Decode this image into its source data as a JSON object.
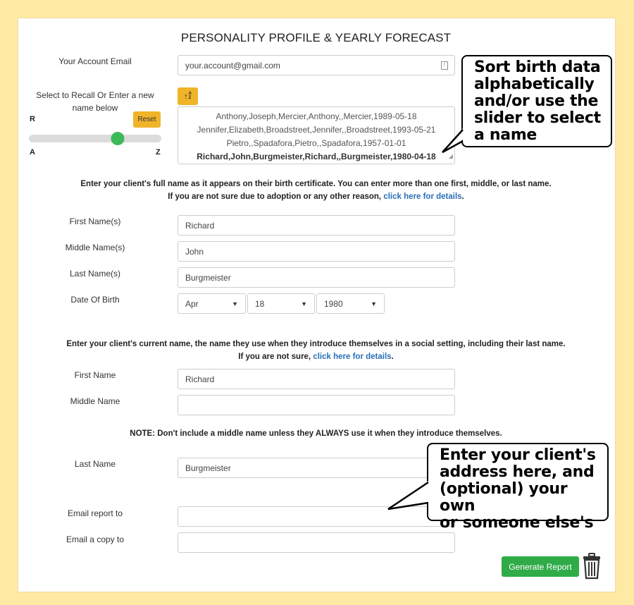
{
  "title": "PERSONALITY PROFILE & YEARLY FORECAST",
  "account": {
    "label": "Your Account Email",
    "value": "your.account@gmail.com",
    "icon": "contact-card-icon"
  },
  "recall": {
    "label": "Select to Recall Or Enter a new name below",
    "current_letter": "R",
    "reset_label": "Reset",
    "slider_min_label": "A",
    "slider_max_label": "Z",
    "slider_fraction": 0.67,
    "sort_icon": "sort-alpha-icon",
    "sort_glyph": "↑",
    "sort_az_top": "A",
    "sort_az_bottom": "Z",
    "names": [
      "Anthony,Joseph,Mercier,Anthony,,Mercier,1989-05-18",
      "Jennifer,Elizabeth,Broadstreet,Jennifer,,Broadstreet,1993-05-21",
      "Pietro,,Spadafora,Pietro,,Spadafora,1957-01-01",
      "Richard,John,Burgmeister,Richard,,Burgmeister,1980-04-18"
    ],
    "selected_index": 3
  },
  "birth_notice": {
    "line1": "Enter your client's full name as it appears on their birth certificate. You can enter more than one first, middle, or last name.",
    "line2_prefix": "If you are not sure due to adoption or any other reason, ",
    "link": "click here for details",
    "suffix": "."
  },
  "birth": {
    "first_label": "First Name(s)",
    "first_value": "Richard",
    "middle_label": "Middle Name(s)",
    "middle_value": "John",
    "last_label": "Last Name(s)",
    "last_value": "Burgmeister",
    "dob_label": "Date Of Birth",
    "month": "Apr",
    "day": "18",
    "year": "1980"
  },
  "current_notice": {
    "line1": "Enter your client's current name, the name they use when they introduce themselves in a social setting, including their last name.",
    "line2_prefix": "If you are not sure, ",
    "link": "click here for details",
    "suffix": "."
  },
  "current": {
    "first_label": "First Name",
    "first_value": "Richard",
    "middle_label": "Middle Name",
    "middle_value": "",
    "note": "NOTE: Don't include a middle name unless they ALWAYS use it when they introduce themselves.",
    "last_label": "Last Name",
    "last_value": "Burgmeister"
  },
  "email": {
    "report_label": "Email report to",
    "report_value": "",
    "copy_label": "Email a copy to",
    "copy_value": ""
  },
  "actions": {
    "generate_label": "Generate Report",
    "trash_icon": "trash-icon"
  },
  "callouts": {
    "sort": [
      "Sort birth data",
      "alphabetically",
      "and/or use the",
      "slider to select",
      "a name"
    ],
    "address": [
      "Enter your client's",
      "address here, and",
      "(optional) your own",
      "or someone else's"
    ]
  },
  "colors": {
    "background": "#ffeaa3",
    "warning_button": "#f0b429",
    "success_button": "#2fab48",
    "slider_thumb": "#3cb95a",
    "link": "#2a6fb8"
  }
}
